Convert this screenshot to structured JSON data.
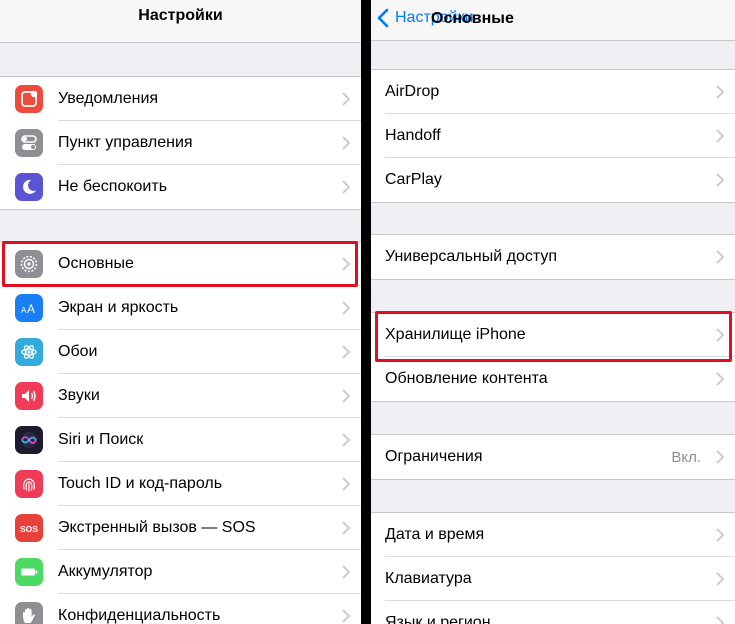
{
  "left": {
    "title": "Настройки",
    "groups": [
      {
        "items": [
          {
            "label": "Уведомления",
            "icon": "notifications-icon",
            "color": "#ef4b3d"
          },
          {
            "label": "Пункт управления",
            "icon": "control-center-icon",
            "color": "#8e8e93"
          },
          {
            "label": "Не беспокоить",
            "icon": "moon-icon",
            "color": "#5b55d6"
          }
        ]
      },
      {
        "items": [
          {
            "label": "Основные",
            "icon": "gear-icon",
            "color": "#8e8e93",
            "highlighted": true
          },
          {
            "label": "Экран и яркость",
            "icon": "display-brightness-icon",
            "color": "#1a7ff5"
          },
          {
            "label": "Обои",
            "icon": "wallpaper-icon",
            "color": "#33aadc"
          },
          {
            "label": "Звуки",
            "icon": "speaker-icon",
            "color": "#ef3b57"
          },
          {
            "label": "Siri и Поиск",
            "icon": "siri-icon",
            "color": "#1c1c2e"
          },
          {
            "label": "Touch ID и код-пароль",
            "icon": "fingerprint-icon",
            "color": "#ef3b57"
          },
          {
            "label": "Экстренный вызов — SOS",
            "icon": "sos-icon",
            "color": "#e8403a"
          },
          {
            "label": "Аккумулятор",
            "icon": "battery-icon",
            "color": "#4cd964"
          },
          {
            "label": "Конфиденциальность",
            "icon": "hand-icon",
            "color": "#8e8e93"
          }
        ]
      }
    ]
  },
  "right": {
    "back_label": "Настройки",
    "title": "Основные",
    "groups": [
      {
        "items": [
          {
            "label": "AirDrop"
          },
          {
            "label": "Handoff"
          },
          {
            "label": "CarPlay"
          }
        ]
      },
      {
        "items": [
          {
            "label": "Универсальный доступ"
          }
        ]
      },
      {
        "items": [
          {
            "label": "Хранилище iPhone",
            "highlighted": true
          },
          {
            "label": "Обновление контента"
          }
        ]
      },
      {
        "items": [
          {
            "label": "Ограничения",
            "value": "Вкл."
          }
        ]
      },
      {
        "items": [
          {
            "label": "Дата и время"
          },
          {
            "label": "Клавиатура"
          },
          {
            "label": "Язык и регион"
          }
        ]
      }
    ]
  },
  "colors": {
    "accent": "#007aff",
    "highlight": "#e0101e"
  }
}
